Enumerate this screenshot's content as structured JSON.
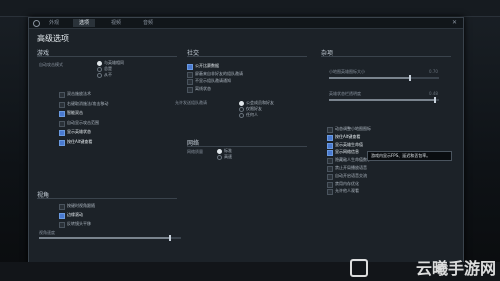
{
  "topbar": {
    "items": [
      "",
      "",
      "",
      "",
      ""
    ]
  },
  "tabs": [
    {
      "label": "外观"
    },
    {
      "label": "选项"
    },
    {
      "label": "视频"
    },
    {
      "label": "音频"
    }
  ],
  "dialog": {
    "title": "高级选项",
    "advanced_toggle": "▲ 隐藏高级选项"
  },
  "game": {
    "header": "游戏",
    "unit_label": "自动攻击模式",
    "radios": [
      {
        "label": "与英雄相同",
        "on": true
      },
      {
        "label": "总是",
        "on": false
      },
      {
        "label": "从不",
        "on": false
      }
    ],
    "checks": [
      {
        "label": "双击施放法术",
        "on": false
      },
      {
        "label": "右键取消施法/攻击移动",
        "on": false
      },
      {
        "label": "智能双击",
        "on": true
      },
      {
        "label": "自动显示攻击范围",
        "on": false
      },
      {
        "label": "显示英雄状态",
        "on": true
      },
      {
        "label": "按住Alt键查看",
        "on": true
      }
    ]
  },
  "social": {
    "header": "社交",
    "checks": [
      {
        "label": "公开比赛数据",
        "on": true
      },
      {
        "label": "屏蔽来自非好友的组队邀请",
        "on": false
      },
      {
        "label": "不显示组队邀请通知",
        "on": false
      },
      {
        "label": "离线状态",
        "on": false
      }
    ],
    "party_label": "允许发送组队邀请",
    "party_radios": [
      {
        "label": "公会成员和好友",
        "on": true
      },
      {
        "label": "仅限好友",
        "on": false
      },
      {
        "label": "任何人",
        "on": false
      }
    ]
  },
  "network": {
    "header": "网络",
    "label": "网络质量",
    "radios": [
      {
        "label": "标准",
        "on": true
      },
      {
        "label": "高速",
        "on": false
      }
    ]
  },
  "camera": {
    "header": "视角",
    "checks": [
      {
        "label": "按键时视角跟随",
        "on": false
      },
      {
        "label": "边缘滚动",
        "on": true
      },
      {
        "label": "反转镜头平移",
        "on": false
      }
    ],
    "speed_label": "视角速度",
    "speed_value": 0.92
  },
  "misc": {
    "header": "杂项",
    "slider1": {
      "label": "小地图英雄图标大小",
      "value": 0.74,
      "display": "0.70"
    },
    "slider2": {
      "label": "英雄状态栏透明度",
      "value": 0.96,
      "display": "0.48"
    },
    "checks": [
      {
        "label": "动态调整小地图图标",
        "on": false
      },
      {
        "label": "按住Alt键查看",
        "on": true
      },
      {
        "label": "显示英雄生命值",
        "on": true
      },
      {
        "label": "显示网络信息",
        "on": true
      },
      {
        "label": "隐藏敌人生命值数字",
        "on": false
      },
      {
        "label": "禁止开局播放语音",
        "on": false
      },
      {
        "label": "自动开启语音交流",
        "on": false
      },
      {
        "label": "禁用内存优化",
        "on": false
      },
      {
        "label": "允许他人观看",
        "on": false
      }
    ],
    "tooltip": "游戏内显示FPS、延迟和丢包率。"
  },
  "watermark": {
    "text": "云曦手游网"
  }
}
